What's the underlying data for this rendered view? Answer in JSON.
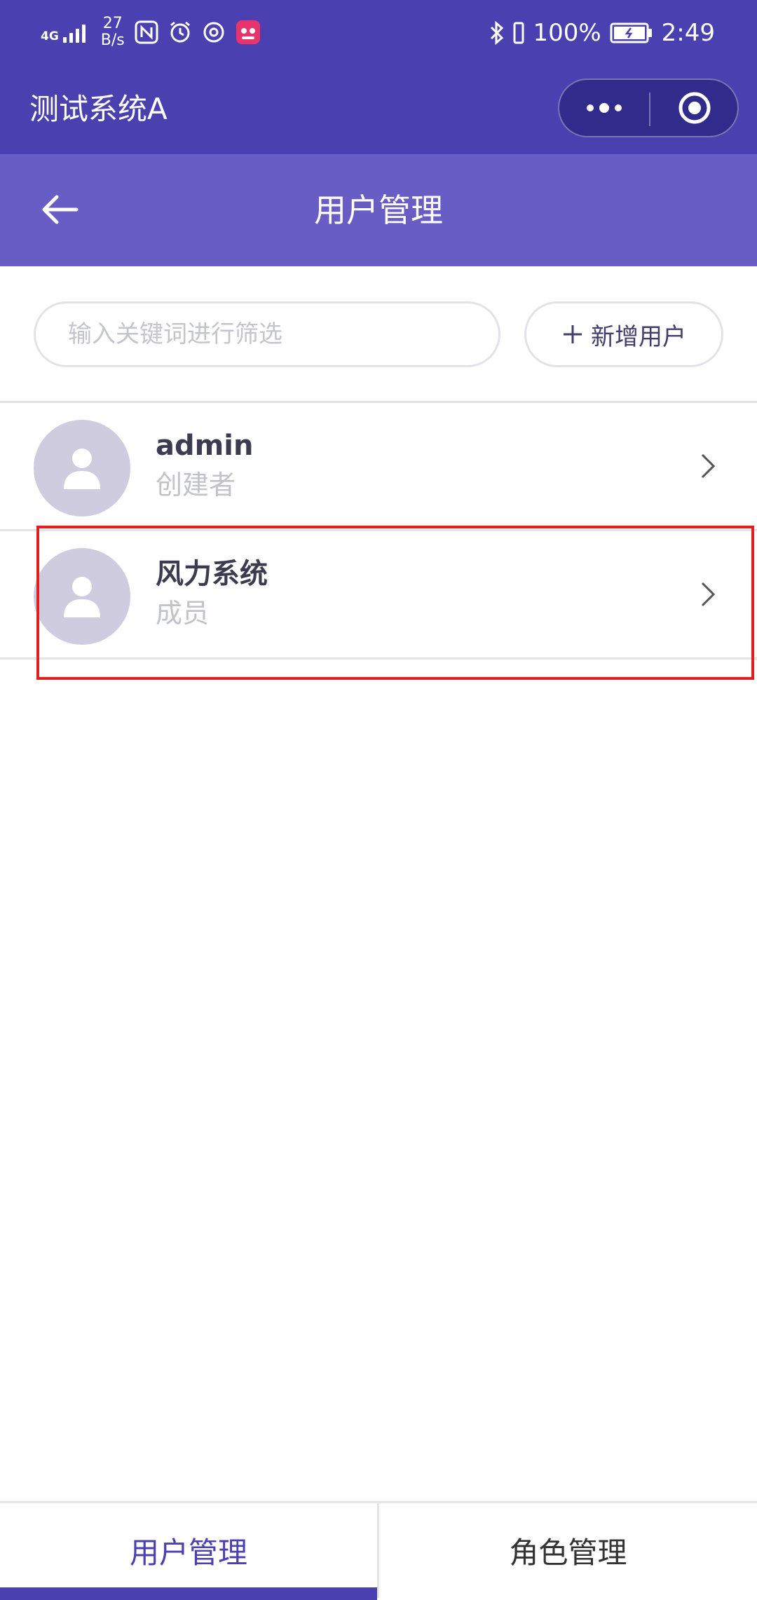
{
  "status_bar": {
    "network": "4G",
    "speed_value": "27",
    "speed_unit": "B/s",
    "battery": "100%",
    "time": "2:49"
  },
  "title_bar": {
    "app_title": "测试系统A",
    "more_icon": "more-dots-icon",
    "close_icon": "target-close-icon"
  },
  "nav": {
    "title": "用户管理",
    "back_icon": "arrow-left-icon"
  },
  "filter": {
    "search_placeholder": "输入关键词进行筛选",
    "search_value": "",
    "add_button_label": "新增用户",
    "add_icon": "plus-icon"
  },
  "users": [
    {
      "name": "admin",
      "role": "创建者"
    },
    {
      "name": "风力系统",
      "role": "成员"
    }
  ],
  "tabs": [
    {
      "label": "用户管理",
      "active": true
    },
    {
      "label": "角色管理",
      "active": false
    }
  ],
  "colors": {
    "header": "#4a40b0",
    "navbar": "#675dc4",
    "accent": "#4a40b0",
    "highlight": "#e02020"
  }
}
